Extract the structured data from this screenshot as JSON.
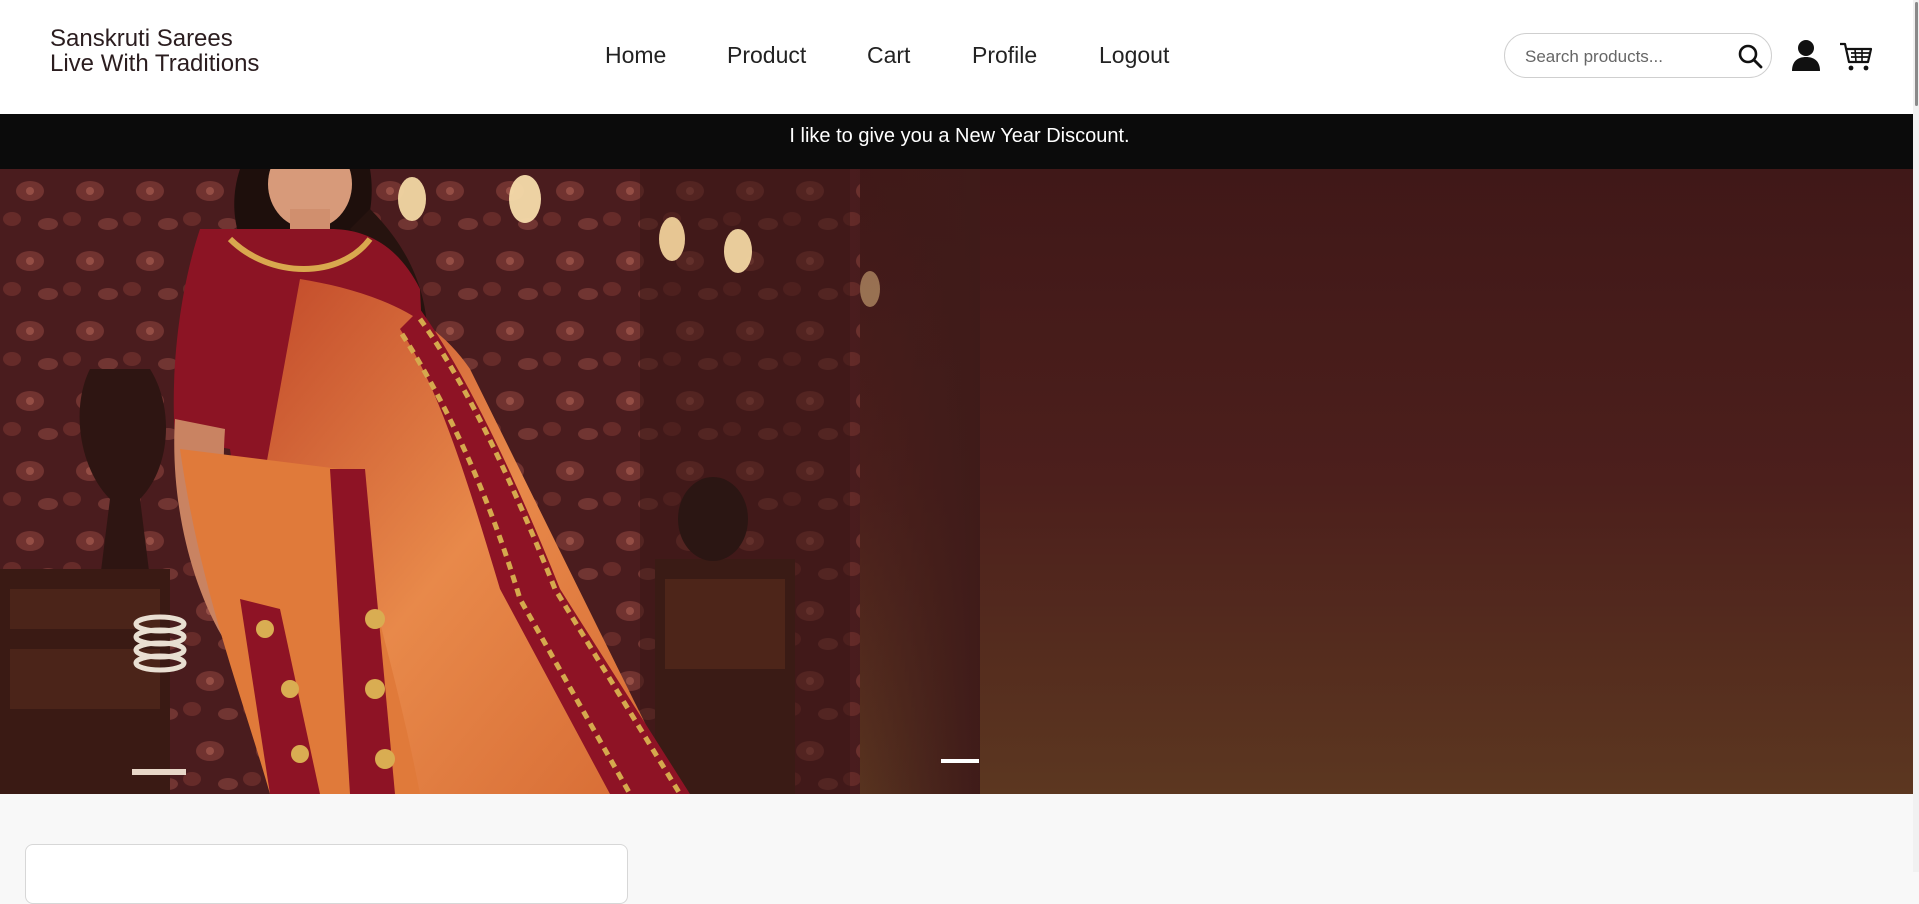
{
  "brand": {
    "line1": "Sanskruti Sarees",
    "line2": "Live With Traditions"
  },
  "nav": {
    "items": [
      {
        "label": "Home"
      },
      {
        "label": "Product"
      },
      {
        "label": "Cart"
      },
      {
        "label": "Profile"
      },
      {
        "label": "Logout"
      }
    ]
  },
  "search": {
    "placeholder": "Search products...",
    "value": "",
    "icon": "search-icon"
  },
  "header_icons": {
    "user": "user-icon",
    "cart": "cart-icon"
  },
  "announcement": {
    "text": "I like to give you a New Year Discount."
  },
  "hero": {
    "slide_count": 1,
    "active_slide": 1,
    "image_subject": "woman in red and orange embroidered saree"
  },
  "colors": {
    "announcement_bg": "#0b0b0b",
    "hero_bg": "#4a1e1c",
    "accent_maroon": "#8c1522",
    "accent_orange": "#e07a3a"
  }
}
